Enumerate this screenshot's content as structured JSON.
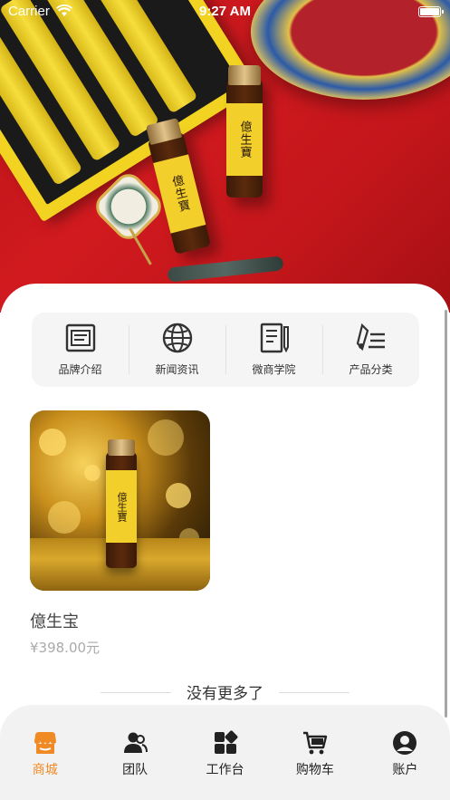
{
  "status_bar": {
    "carrier": "Carrier",
    "time": "9:27 AM"
  },
  "quick_menu": [
    {
      "label": "品牌介绍",
      "icon": "brand-intro-icon"
    },
    {
      "label": "新闻资讯",
      "icon": "news-icon"
    },
    {
      "label": "微商学院",
      "icon": "academy-icon"
    },
    {
      "label": "产品分类",
      "icon": "category-icon"
    }
  ],
  "hero": {
    "bottle_label": "億生寶"
  },
  "products": [
    {
      "name": "億生宝",
      "price": "¥398.00元"
    }
  ],
  "footer": {
    "no_more": "没有更多了"
  },
  "tabs": [
    {
      "label": "商城",
      "icon": "shop-icon",
      "active": true
    },
    {
      "label": "团队",
      "icon": "team-icon",
      "active": false
    },
    {
      "label": "工作台",
      "icon": "workbench-icon",
      "active": false
    },
    {
      "label": "购物车",
      "icon": "cart-icon",
      "active": false
    },
    {
      "label": "账户",
      "icon": "account-icon",
      "active": false
    }
  ],
  "colors": {
    "accent": "#f08a24",
    "hero_red": "#c3161b",
    "label_yellow": "#f2cf2b"
  }
}
